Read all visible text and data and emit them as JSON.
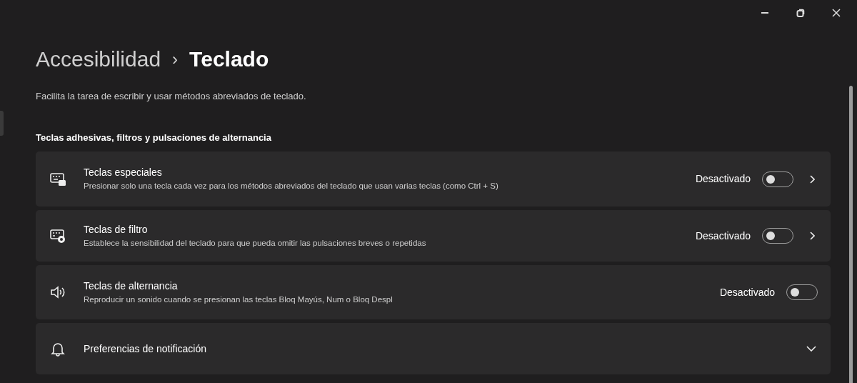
{
  "breadcrumb": {
    "parent": "Accesibilidad",
    "separator": "›",
    "current": "Teclado"
  },
  "description": "Facilita la tarea de escribir y usar métodos abreviados de teclado.",
  "section_title": "Teclas adhesivas, filtros y pulsaciones de alternancia",
  "settings": [
    {
      "kind": "toggle_link",
      "title": "Teclas especiales",
      "subtitle": "Presionar solo una tecla cada vez para los métodos abreviados del teclado que usan varias teclas (como Ctrl + S)",
      "state_label": "Desactivado",
      "on": false
    },
    {
      "kind": "toggle_link",
      "title": "Teclas de filtro",
      "subtitle": "Establece la sensibilidad del teclado para que pueda omitir las pulsaciones breves o repetidas",
      "state_label": "Desactivado",
      "on": false
    },
    {
      "kind": "toggle",
      "title": "Teclas de alternancia",
      "subtitle": "Reproducir un sonido cuando se presionan las teclas Bloq Mayús, Num o Bloq Despl",
      "state_label": "Desactivado",
      "on": false
    },
    {
      "kind": "expander",
      "title": "Preferencias de notificación",
      "expanded": false
    }
  ]
}
